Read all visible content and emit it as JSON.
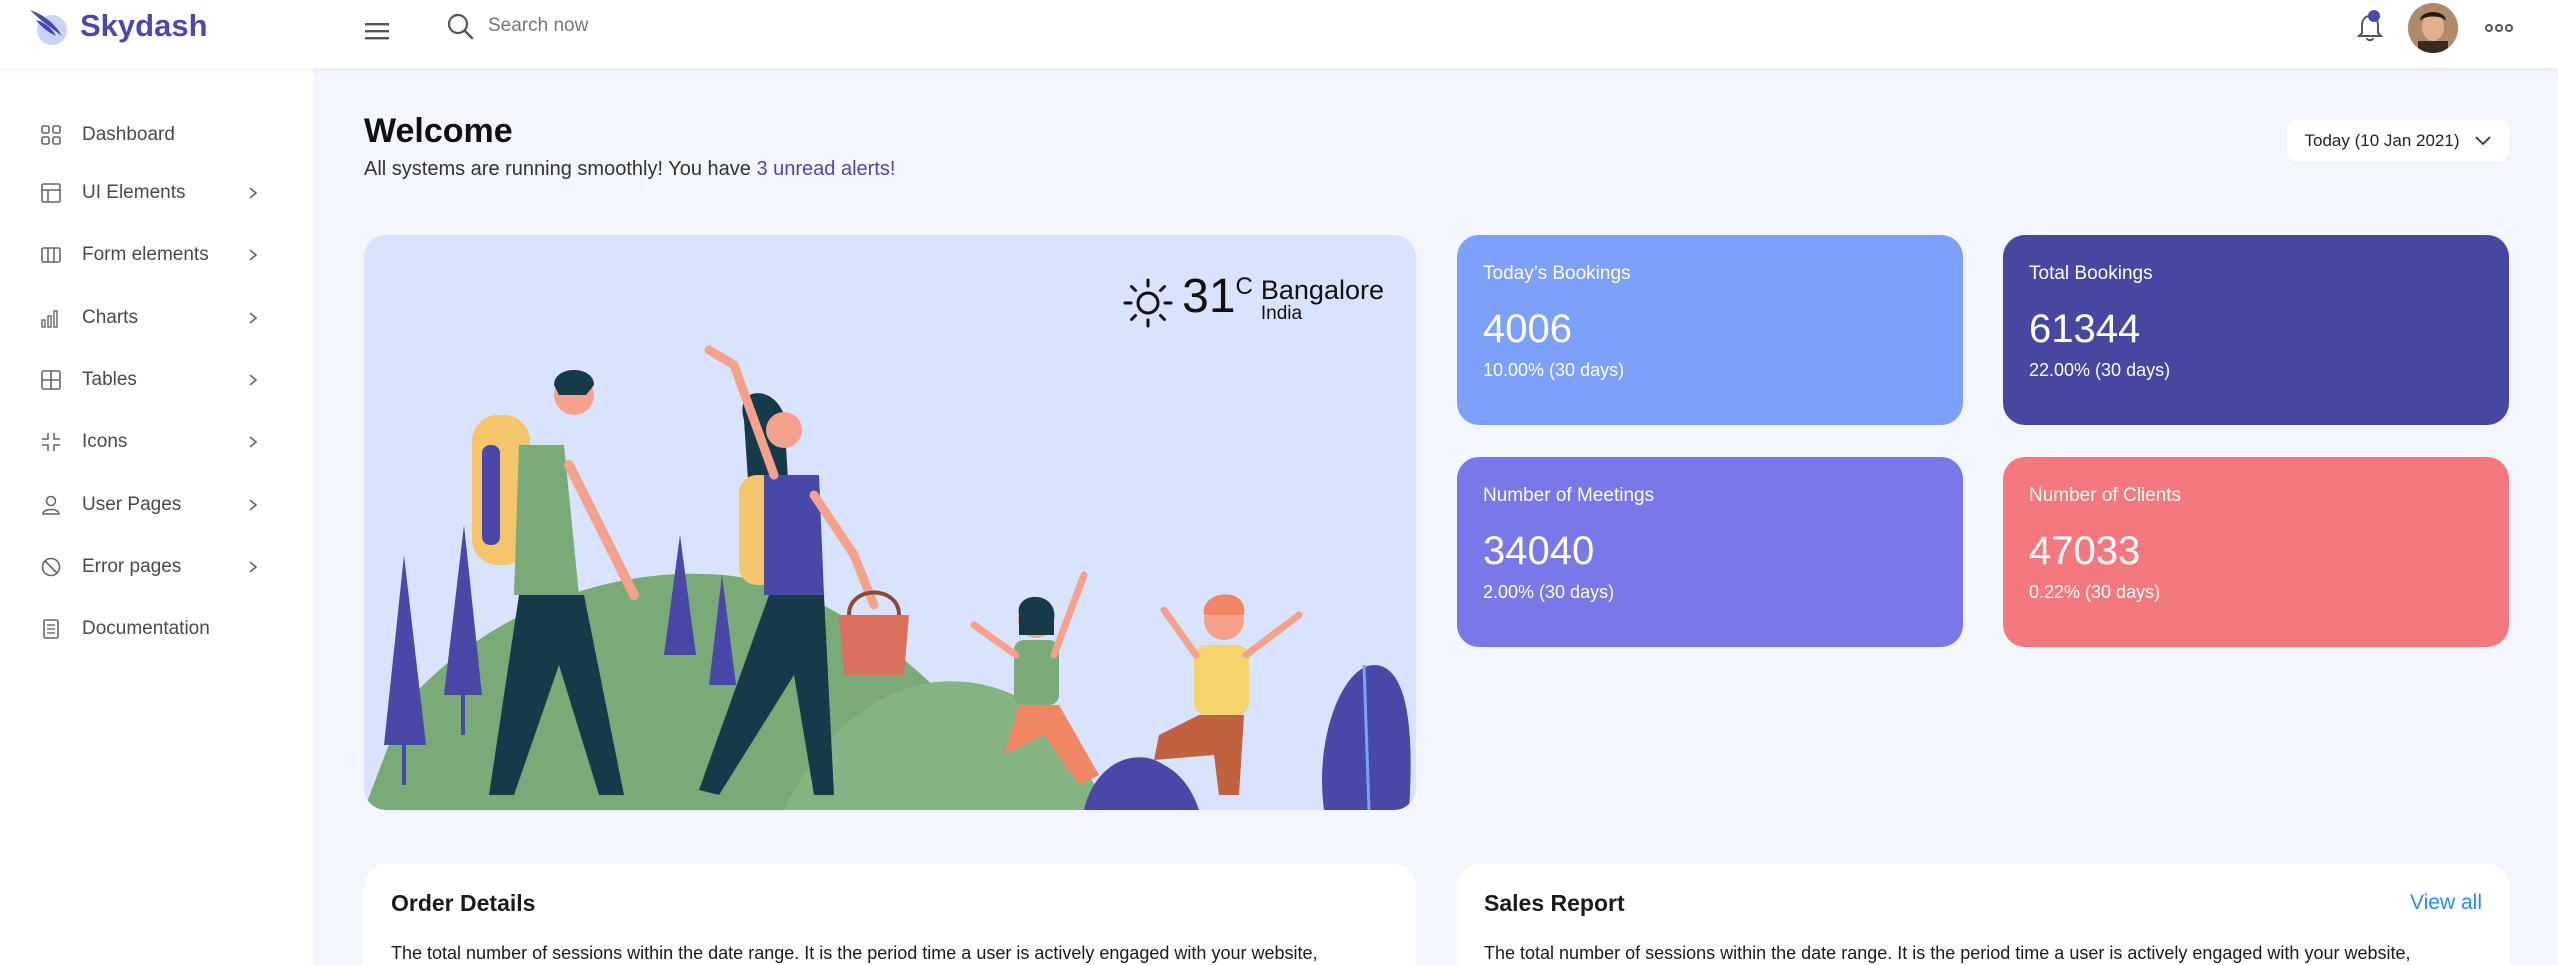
{
  "brand": {
    "name": "Skydash"
  },
  "search": {
    "placeholder": "Search now"
  },
  "sidebar": {
    "items": [
      {
        "label": "Dashboard",
        "icon": "grid-icon",
        "chevron": false
      },
      {
        "label": "UI Elements",
        "icon": "layout-icon",
        "chevron": true
      },
      {
        "label": "Form elements",
        "icon": "columns-icon",
        "chevron": true
      },
      {
        "label": "Charts",
        "icon": "bar-chart-icon",
        "chevron": true
      },
      {
        "label": "Tables",
        "icon": "table-icon",
        "chevron": true
      },
      {
        "label": "Icons",
        "icon": "contract-icon",
        "chevron": true
      },
      {
        "label": "User Pages",
        "icon": "user-icon",
        "chevron": true
      },
      {
        "label": "Error pages",
        "icon": "ban-icon",
        "chevron": true
      },
      {
        "label": "Documentation",
        "icon": "document-icon",
        "chevron": false
      }
    ]
  },
  "welcome": {
    "title": "Welcome",
    "subtitle_prefix": "All systems are running smoothly! You have ",
    "alerts_link": "3 unread alerts!"
  },
  "date_filter": {
    "label": "Today (10 Jan 2021)"
  },
  "weather": {
    "temp": "31",
    "unit": "C",
    "city": "Bangalore",
    "country": "India"
  },
  "stats": [
    {
      "label": "Today’s Bookings",
      "value": "4006",
      "sub": "10.00% (30 days)",
      "color": "#7da0fa"
    },
    {
      "label": "Total Bookings",
      "value": "61344",
      "sub": "22.00% (30 days)",
      "color": "#4747a1"
    },
    {
      "label": "Number of Meetings",
      "value": "34040",
      "sub": "2.00% (30 days)",
      "color": "#7978e9"
    },
    {
      "label": "Number of Clients",
      "value": "47033",
      "sub": "0.22% (30 days)",
      "color": "#f3797e"
    }
  ],
  "panels": {
    "order": {
      "title": "Order Details",
      "text": "The total number of sessions within the date range. It is the period time a user is actively engaged with your website,"
    },
    "sales": {
      "title": "Sales Report",
      "link": "View all",
      "text": "The total number of sessions within the date range. It is the period time a user is actively engaged with your website,"
    }
  },
  "colors": {
    "brand": "#4b49ac",
    "background": "#f4f6fe",
    "hero": "#dae3fd",
    "link": "#248afd"
  }
}
